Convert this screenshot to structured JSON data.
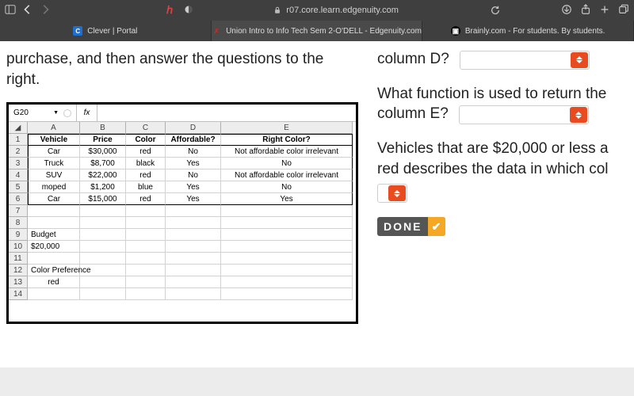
{
  "browser": {
    "url": "r07.core.learn.edgenuity.com",
    "tabs": [
      {
        "label": "Clever | Portal",
        "fav": "C"
      },
      {
        "label": "Union Intro to Info Tech Sem 2-O'DELL - Edgenuity.com",
        "fav": "✗"
      },
      {
        "label": "Brainly.com - For students. By students.",
        "fav": "▣"
      }
    ]
  },
  "left": {
    "instruction_line1": "purchase, and then answer the questions to the",
    "instruction_line2": "right."
  },
  "spreadsheet": {
    "namebox": "G20",
    "fx_label": "fx",
    "col_letters": [
      "A",
      "B",
      "C",
      "D",
      "E"
    ],
    "headers": [
      "Vehicle",
      "Price",
      "Color",
      "Affordable?",
      "Right Color?"
    ],
    "rows": [
      [
        "Car",
        "$30,000",
        "red",
        "No",
        "Not affordable color irrelevant"
      ],
      [
        "Truck",
        "$8,700",
        "black",
        "Yes",
        "No"
      ],
      [
        "SUV",
        "$22,000",
        "red",
        "No",
        "Not affordable color irrelevant"
      ],
      [
        "moped",
        "$1,200",
        "blue",
        "Yes",
        "No"
      ],
      [
        "Car",
        "$15,000",
        "red",
        "Yes",
        "Yes"
      ]
    ],
    "budget_label": "Budget",
    "budget_value": "$20,000",
    "pref_label": "Color Preference",
    "pref_value": "red",
    "row_nums": [
      "1",
      "2",
      "3",
      "4",
      "5",
      "6",
      "7",
      "8",
      "9",
      "10",
      "11",
      "12",
      "13",
      "14"
    ]
  },
  "questions": {
    "q1_tail": "column D?",
    "q2": "What function is used to return the",
    "q2_tail": "column E?",
    "q3_l1": "Vehicles that are $20,000 or less a",
    "q3_l2": "red describes the data in which col",
    "done": "DONE"
  },
  "chart_data": {
    "type": "table",
    "title": "Spreadsheet",
    "columns": [
      "Vehicle",
      "Price",
      "Color",
      "Affordable?",
      "Right Color?"
    ],
    "rows": [
      [
        "Car",
        "$30,000",
        "red",
        "No",
        "Not affordable color irrelevant"
      ],
      [
        "Truck",
        "$8,700",
        "black",
        "Yes",
        "No"
      ],
      [
        "SUV",
        "$22,000",
        "red",
        "No",
        "Not affordable color irrelevant"
      ],
      [
        "moped",
        "$1,200",
        "blue",
        "Yes",
        "No"
      ],
      [
        "Car",
        "$15,000",
        "red",
        "Yes",
        "Yes"
      ]
    ],
    "extras": {
      "Budget": "$20,000",
      "Color Preference": "red"
    }
  }
}
